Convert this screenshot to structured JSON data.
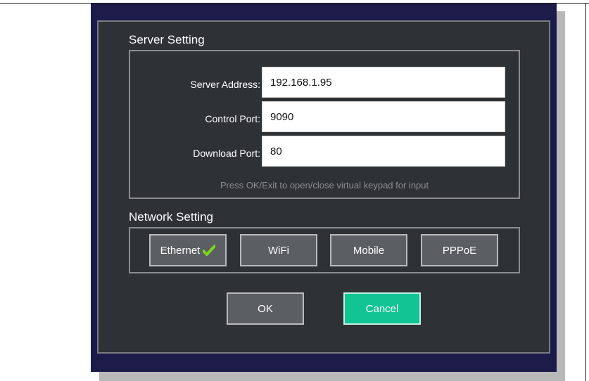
{
  "server_setting": {
    "title": "Server Setting",
    "fields": [
      {
        "label": "Server Address:",
        "value": "192.168.1.95"
      },
      {
        "label": "Control Port:",
        "value": "9090"
      },
      {
        "label": "Download Port:",
        "value": "80"
      }
    ],
    "hint": "Press OK/Exit to open/close virtual keypad for input"
  },
  "network_setting": {
    "title": "Network Setting",
    "options": [
      {
        "label": "Ethernet",
        "selected": true,
        "icon": "check-icon"
      },
      {
        "label": "WiFi",
        "selected": false
      },
      {
        "label": "Mobile",
        "selected": false
      },
      {
        "label": "PPPoE",
        "selected": false
      }
    ]
  },
  "actions": {
    "ok_label": "OK",
    "cancel_label": "Cancel"
  },
  "colors": {
    "dialog_frame": "#1d1b4a",
    "panel_bg": "#2f3235",
    "accent": "#12c493",
    "check": "#7ed321"
  }
}
